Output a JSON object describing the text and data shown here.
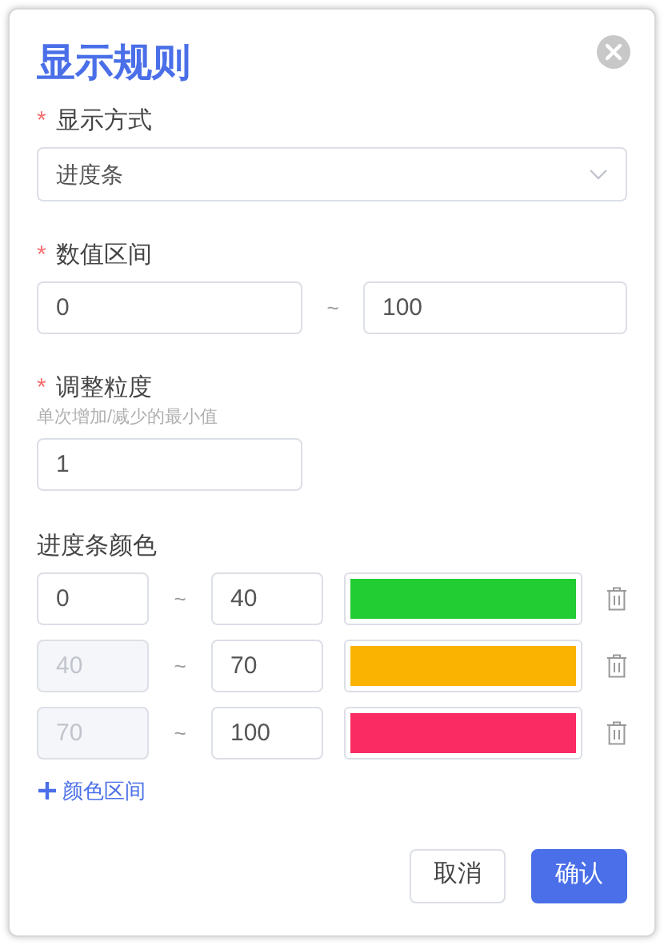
{
  "dialog": {
    "title": "显示规则"
  },
  "display_mode": {
    "label": "显示方式",
    "required_mark": "*",
    "value": "进度条"
  },
  "value_range": {
    "label": "数值区间",
    "required_mark": "*",
    "from": "0",
    "separator": "~",
    "to": "100"
  },
  "step": {
    "label": "调整粒度",
    "required_mark": "*",
    "hint": "单次增加/减少的最小值",
    "value": "1"
  },
  "color_ranges": {
    "label": "进度条颜色",
    "rows": [
      {
        "from": "0",
        "from_disabled": false,
        "separator": "~",
        "to": "40",
        "color": "#22cc33"
      },
      {
        "from": "40",
        "from_disabled": true,
        "separator": "~",
        "to": "70",
        "color": "#fab300"
      },
      {
        "from": "70",
        "from_disabled": true,
        "separator": "~",
        "to": "100",
        "color": "#fa2a62"
      }
    ],
    "add_label": "颜色区间"
  },
  "buttons": [
    {
      "label": "取消",
      "kind": "secondary"
    },
    {
      "label": "确认",
      "kind": "primary"
    }
  ]
}
